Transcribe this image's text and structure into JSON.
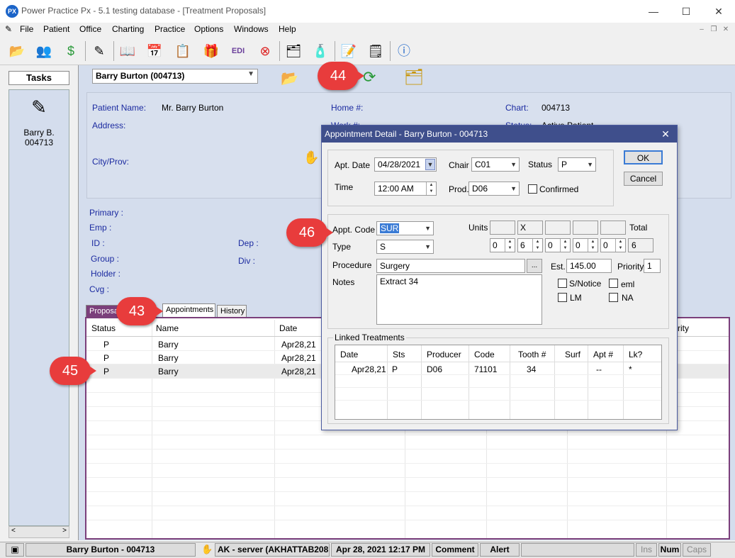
{
  "window": {
    "app_icon_text": "PX",
    "title": "Power Practice Px - 5.1 testing database - [Treatment Proposals]",
    "minimize": "—",
    "maximize": "☐",
    "close": "✕"
  },
  "menu": [
    "File",
    "Patient",
    "Office",
    "Charting",
    "Practice",
    "Options",
    "Windows",
    "Help"
  ],
  "mdi": {
    "minimize": "–",
    "restore": "❐",
    "close": "✕"
  },
  "tasks": {
    "label": "Tasks",
    "item_line1": "Barry B.",
    "item_line2": "004713"
  },
  "patient_selector": "Barry Burton (004713)",
  "info": {
    "patient_name_label": "Patient Name:",
    "patient_name_value": "Mr. Barry Burton",
    "address_label": "Address:",
    "city_label": "City/Prov:",
    "home_label": "Home #:",
    "work_label": "Work #:",
    "chart_label": "Chart:",
    "chart_value": "004713",
    "status_label": "Status:",
    "status_value": "Active Patient",
    "primary_label": "Primary :",
    "emp_label": "Emp :",
    "id_label": "ID :",
    "dep_label": "Dep :",
    "group_label": "Group :",
    "div_label": "Div :",
    "holder_label": "Holder :",
    "cvg_label": "Cvg :"
  },
  "tabs": [
    "Proposals",
    "Appointments",
    "History"
  ],
  "grid": {
    "headers": [
      "Status",
      "Name",
      "Date",
      "rity"
    ],
    "rows": [
      {
        "status": "P",
        "name": "Barry",
        "date": "Apr28,21"
      },
      {
        "status": "P",
        "name": "Barry",
        "date": "Apr28,21"
      },
      {
        "status": "P",
        "name": "Barry",
        "date": "Apr28,21"
      }
    ]
  },
  "statusbar": {
    "patient": "Barry Burton - 004713",
    "server": "AK - server (AKHATTAB208",
    "datetime": "Apr 28, 2021 12:17 PM",
    "comment": "Comment",
    "alert": "Alert",
    "ins": "Ins",
    "num": "Num",
    "caps": "Caps"
  },
  "dialog": {
    "title": "Appointment Detail - Barry Burton - 004713",
    "apt_date_label": "Apt. Date",
    "apt_date_value": "04/28/2021",
    "time_label": "Time",
    "time_value": "12:00 AM",
    "chair_label": "Chair",
    "chair_value": "C01",
    "prod_label": "Prod.",
    "prod_value": "D06",
    "status_label": "Status",
    "status_value": "P",
    "confirmed_label": "Confirmed",
    "ok_label": "OK",
    "cancel_label": "Cancel",
    "appt_code_label": "Appt. Code",
    "appt_code_value": "SUR",
    "type_label": "Type",
    "type_value": "S",
    "units_label": "Units",
    "unit_box2": "X",
    "unit_values": [
      "0",
      "6",
      "0",
      "0",
      "0"
    ],
    "total_label": "Total",
    "total_value": "6",
    "procedure_label": "Procedure",
    "procedure_value": "Surgery",
    "ellipsis": "...",
    "est_label": "Est.",
    "est_value": "145.00",
    "priority_label": "Priority",
    "priority_value": "1",
    "notes_label": "Notes",
    "notes_value": "Extract 34",
    "snotice_label": "S/Notice",
    "eml_label": "eml",
    "lm_label": "LM",
    "na_label": "NA",
    "linked_label": "Linked Treatments",
    "linked_headers": [
      "Date",
      "Sts",
      "Producer",
      "Code",
      "Tooth #",
      "Surf",
      "Apt #",
      "Lk?"
    ],
    "linked_row": {
      "date": "Apr28,21",
      "sts": "P",
      "producer": "D06",
      "code": "71101",
      "tooth": "34",
      "surf": "",
      "apt": "--",
      "lk": "*"
    }
  },
  "callouts": [
    "43",
    "44",
    "45",
    "46"
  ],
  "colors": {
    "callout": "#e83c3c",
    "dialog_title": "#3f4f8c",
    "panel": "#d4dded",
    "grid_border": "#7b3f7b",
    "label_blue": "#1b2aa0"
  }
}
